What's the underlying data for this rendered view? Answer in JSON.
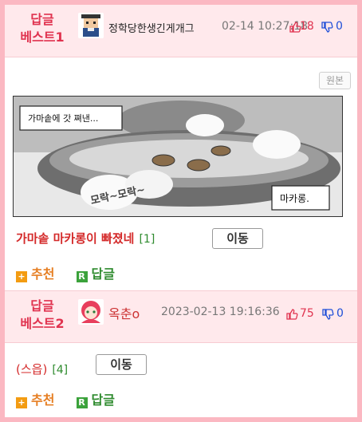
{
  "entries": [
    {
      "label_line1": "답글",
      "label_line2": "베스트1",
      "nickname": "정학당한생긴게개그",
      "date": "02-14 10:27:18",
      "up_count": "18",
      "down_count": "0",
      "original_button": "원본",
      "comic_texts": {
        "bubble_top": "가마솥에 갓 쪄낸...",
        "sfx": "모락~모락~",
        "bubble_right": "마카롱."
      },
      "title": "가마솥 마카롱이 빠졌네",
      "comment_count": "[1]",
      "move_button": "이동",
      "recommend_label": "추천",
      "reply_label": "답글",
      "recommend_icon": "+",
      "reply_icon": "R"
    },
    {
      "label_line1": "답글",
      "label_line2": "베스트2",
      "nickname": "옥춘o",
      "date": "2023-02-13 19:16:36",
      "up_count": "75",
      "down_count": "0",
      "title": "(스읍)",
      "comment_count": "[4]",
      "move_button": "이동",
      "recommend_label": "추천",
      "reply_label": "답글",
      "recommend_icon": "+",
      "reply_icon": "R"
    }
  ],
  "colors": {
    "border": "#fbb8c2",
    "header_bg": "#ffe9ec",
    "label_red": "#e0334f",
    "title_red": "#d42a2a",
    "green": "#2e8b2e",
    "blue": "#1d4ed8"
  }
}
